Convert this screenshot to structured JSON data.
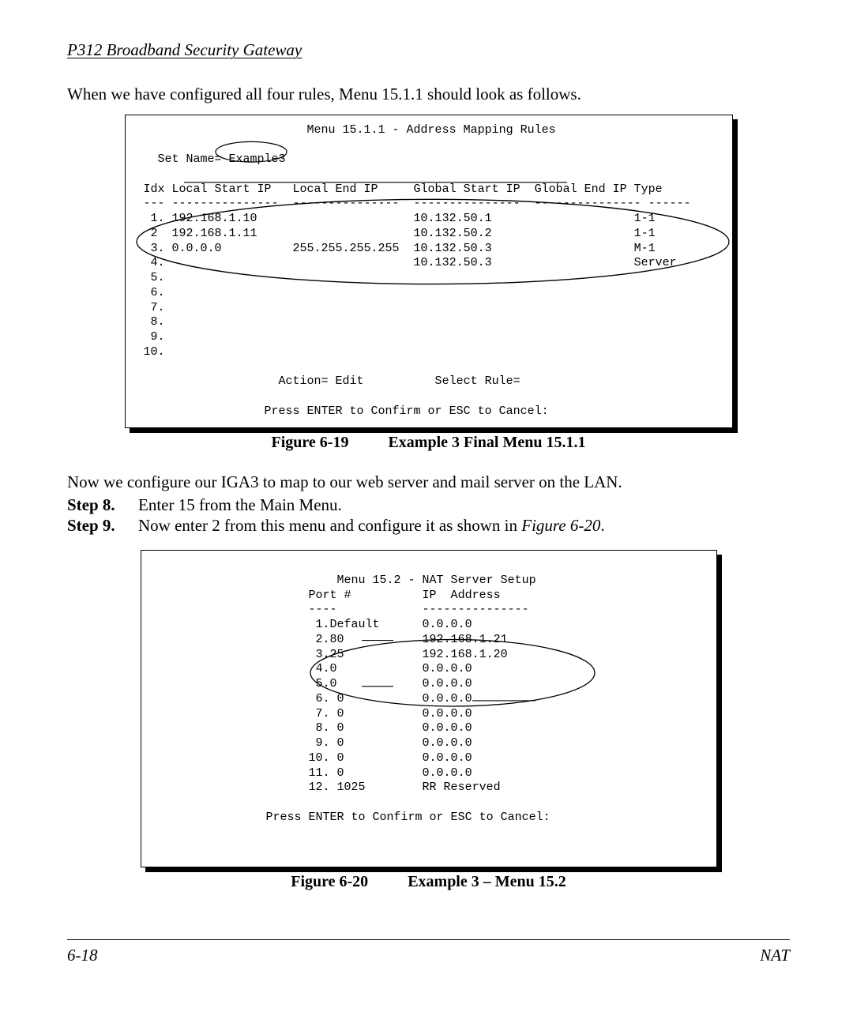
{
  "running_head": "P312  Broadband Security Gateway",
  "intro": "When we have configured all four rules, Menu 15.1.1 should look as follows.",
  "fig1": {
    "number": "Figure 6-19",
    "title": "Example 3 Final Menu 15.1.1",
    "menu_title": "Menu 15.1.1 - Address Mapping Rules",
    "set_name_label": "Set Name=",
    "set_name_value": "Example3",
    "headers": {
      "idx": "Idx",
      "lstart": "Local Start IP",
      "lend": "Local End IP",
      "gstart": "Global Start IP",
      "gend": "Global End IP",
      "type": "Type"
    },
    "rows": [
      {
        "idx": " 1.",
        "lstart": "192.168.1.10",
        "lend": "",
        "gstart": "10.132.50.1",
        "gend": "",
        "type": "1-1"
      },
      {
        "idx": " 2",
        "lstart": "192.168.1.11",
        "lend": "",
        "gstart": "10.132.50.2",
        "gend": "",
        "type": "1-1"
      },
      {
        "idx": " 3.",
        "lstart": "0.0.0.0",
        "lend": "255.255.255.255",
        "gstart": "10.132.50.3",
        "gend": "",
        "type": "M-1"
      },
      {
        "idx": " 4.",
        "lstart": "",
        "lend": "",
        "gstart": "10.132.50.3",
        "gend": "",
        "type": "Server"
      },
      {
        "idx": " 5.",
        "lstart": "",
        "lend": "",
        "gstart": "",
        "gend": "",
        "type": ""
      },
      {
        "idx": " 6.",
        "lstart": "",
        "lend": "",
        "gstart": "",
        "gend": "",
        "type": ""
      },
      {
        "idx": " 7.",
        "lstart": "",
        "lend": "",
        "gstart": "",
        "gend": "",
        "type": ""
      },
      {
        "idx": " 8.",
        "lstart": "",
        "lend": "",
        "gstart": "",
        "gend": "",
        "type": ""
      },
      {
        "idx": " 9.",
        "lstart": "",
        "lend": "",
        "gstart": "",
        "gend": "",
        "type": ""
      },
      {
        "idx": "10.",
        "lstart": "",
        "lend": "",
        "gstart": "",
        "gend": "",
        "type": ""
      }
    ],
    "action_line": "Action= Edit          Select Rule=",
    "footer_line": "Press ENTER to Confirm or ESC to Cancel:"
  },
  "mid_text": "Now we configure our IGA3 to map to our web server and mail server on the LAN.",
  "steps": [
    {
      "label": "Step 8.",
      "text": "Enter 15 from the Main Menu."
    },
    {
      "label": "Step 9.",
      "text_prefix": "Now enter 2 from this menu and configure it as shown in ",
      "text_em": "Figure 6-20",
      "text_suffix": "."
    }
  ],
  "fig2": {
    "number": "Figure 6-20",
    "title": "Example 3 – Menu 15.2",
    "menu_title": "Menu 15.2 - NAT Server Setup",
    "col1": "Port #",
    "col2": "IP  Address",
    "rows": [
      {
        "idx": "1.",
        "port": "Default",
        "ip": "0.0.0.0"
      },
      {
        "idx": "2.",
        "port": "80",
        "ip": "192.168.1.21"
      },
      {
        "idx": "3.",
        "port": "25",
        "ip": "192.168.1.20"
      },
      {
        "idx": "4.",
        "port": "0",
        "ip": "0.0.0.0"
      },
      {
        "idx": "5.",
        "port": "0",
        "ip": "0.0.0.0"
      },
      {
        "idx": "6.",
        "port": " 0",
        "ip": "0.0.0.0"
      },
      {
        "idx": "7.",
        "port": " 0",
        "ip": "0.0.0.0"
      },
      {
        "idx": "8.",
        "port": " 0",
        "ip": "0.0.0.0"
      },
      {
        "idx": "9.",
        "port": " 0",
        "ip": "0.0.0.0"
      },
      {
        "idx": "10.",
        "port": " 0",
        "ip": "0.0.0.0"
      },
      {
        "idx": "11.",
        "port": " 0",
        "ip": "0.0.0.0"
      },
      {
        "idx": "12.",
        "port": " 1025",
        "ip": "RR Reserved"
      }
    ],
    "footer_line": "Press ENTER to Confirm or ESC to Cancel:"
  },
  "footer": {
    "left": "6-18",
    "right": "NAT"
  }
}
